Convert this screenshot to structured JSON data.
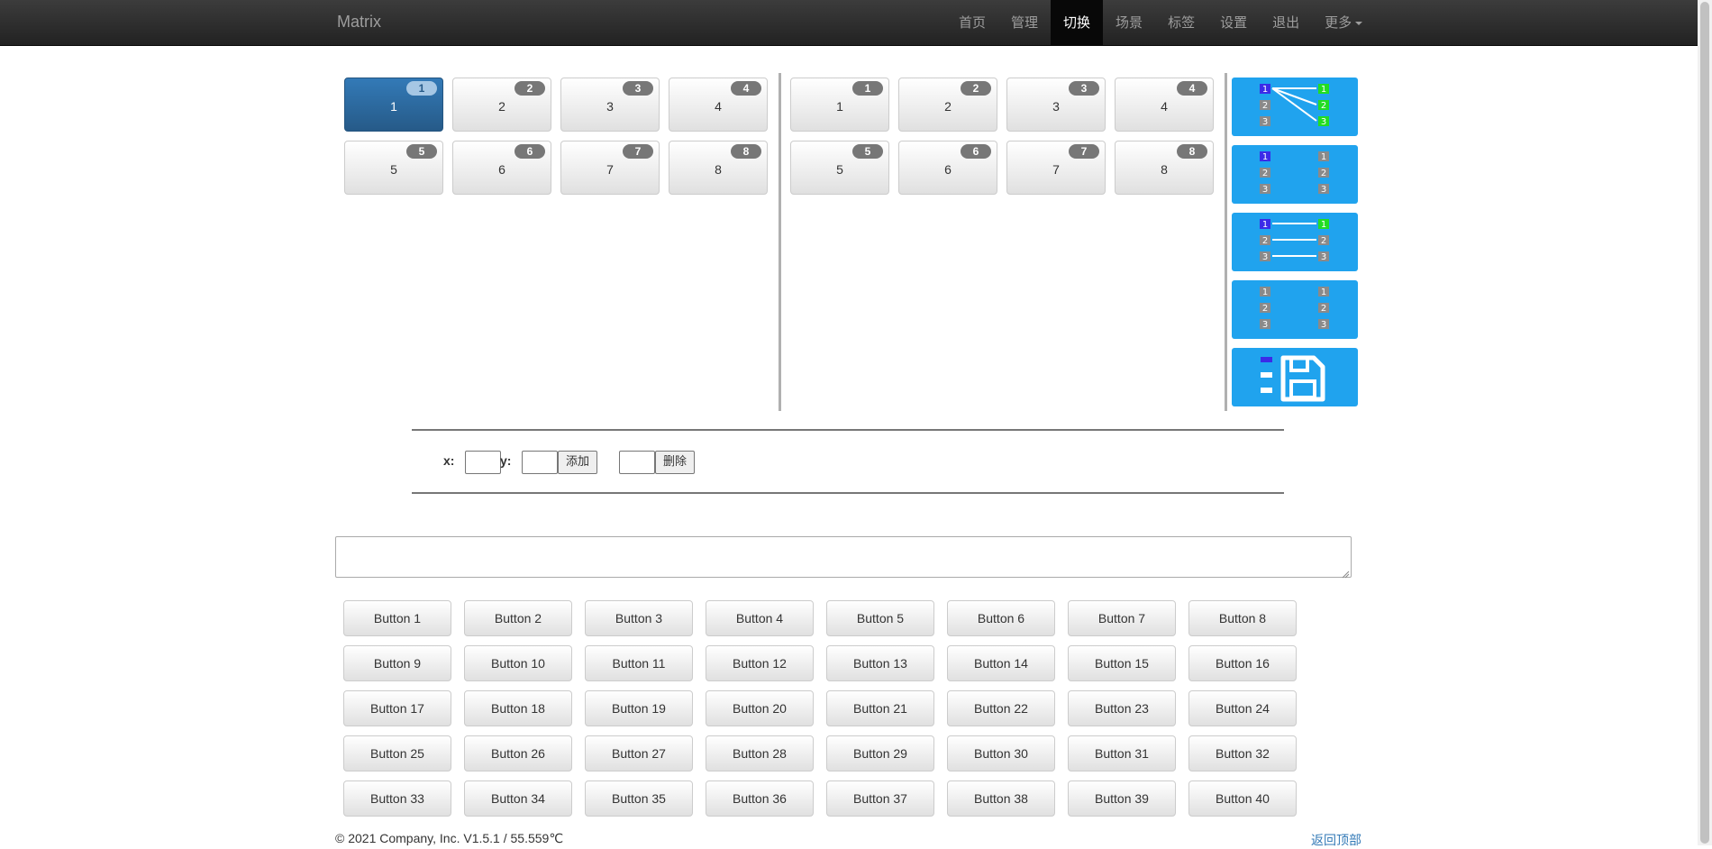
{
  "navbar": {
    "brand": "Matrix",
    "items": [
      {
        "label": "首页",
        "active": false
      },
      {
        "label": "管理",
        "active": false
      },
      {
        "label": "切换",
        "active": true
      },
      {
        "label": "场景",
        "active": false
      },
      {
        "label": "标签",
        "active": false
      },
      {
        "label": "设置",
        "active": false
      },
      {
        "label": "退出",
        "active": false
      },
      {
        "label": "更多",
        "active": false,
        "dropdown": true
      }
    ]
  },
  "inputs": {
    "label": "1",
    "tiles": [
      {
        "label": "1",
        "badge": "1",
        "selected": true
      },
      {
        "label": "2",
        "badge": "2",
        "selected": false
      },
      {
        "label": "3",
        "badge": "3",
        "selected": false
      },
      {
        "label": "4",
        "badge": "4",
        "selected": false
      },
      {
        "label": "5",
        "badge": "5",
        "selected": false
      },
      {
        "label": "6",
        "badge": "6",
        "selected": false
      },
      {
        "label": "7",
        "badge": "7",
        "selected": false
      },
      {
        "label": "8",
        "badge": "8",
        "selected": false
      }
    ]
  },
  "outputs": {
    "tiles": [
      {
        "label": "1",
        "badge": "1"
      },
      {
        "label": "2",
        "badge": "2"
      },
      {
        "label": "3",
        "badge": "3"
      },
      {
        "label": "4",
        "badge": "4"
      },
      {
        "label": "5",
        "badge": "5"
      },
      {
        "label": "6",
        "badge": "6"
      },
      {
        "label": "7",
        "badge": "7"
      },
      {
        "label": "8",
        "badge": "8"
      }
    ]
  },
  "presets": [
    {
      "name": "one-to-all",
      "icon": "fan-out-routing-icon"
    },
    {
      "name": "disconnect-all",
      "icon": "unrouted-grid-icon"
    },
    {
      "name": "one-to-one",
      "icon": "parallel-routing-icon"
    },
    {
      "name": "clear",
      "icon": "gray-grid-icon"
    },
    {
      "name": "save",
      "icon": "floppy-save-icon"
    }
  ],
  "colors": {
    "accent": "#20a3ee",
    "selected": "#337ab7",
    "input_badge": "#3b2be8",
    "output_badge": "#22dd22",
    "idle_badge": "#8a8a8a"
  },
  "coords": {
    "x_label": "x:",
    "y_label": "y:",
    "x_value": "",
    "y_value": "",
    "add_label": "添加",
    "delete_value": "",
    "delete_label": "删除"
  },
  "command": {
    "value": ""
  },
  "buttons": [
    "Button 1",
    "Button 2",
    "Button 3",
    "Button 4",
    "Button 5",
    "Button 6",
    "Button 7",
    "Button 8",
    "Button 9",
    "Button 10",
    "Button 11",
    "Button 12",
    "Button 13",
    "Button 14",
    "Button 15",
    "Button 16",
    "Button 17",
    "Button 18",
    "Button 19",
    "Button 20",
    "Button 21",
    "Button 22",
    "Button 23",
    "Button 24",
    "Button 25",
    "Button 26",
    "Button 27",
    "Button 28",
    "Button 29",
    "Button 30",
    "Button 31",
    "Button 32",
    "Button 33",
    "Button 34",
    "Button 35",
    "Button 36",
    "Button 37",
    "Button 38",
    "Button 39",
    "Button 40"
  ],
  "footer": {
    "copyright": "© 2021 Company, Inc. V1.5.1 / 55.559℃",
    "back_to_top": "返回顶部"
  }
}
